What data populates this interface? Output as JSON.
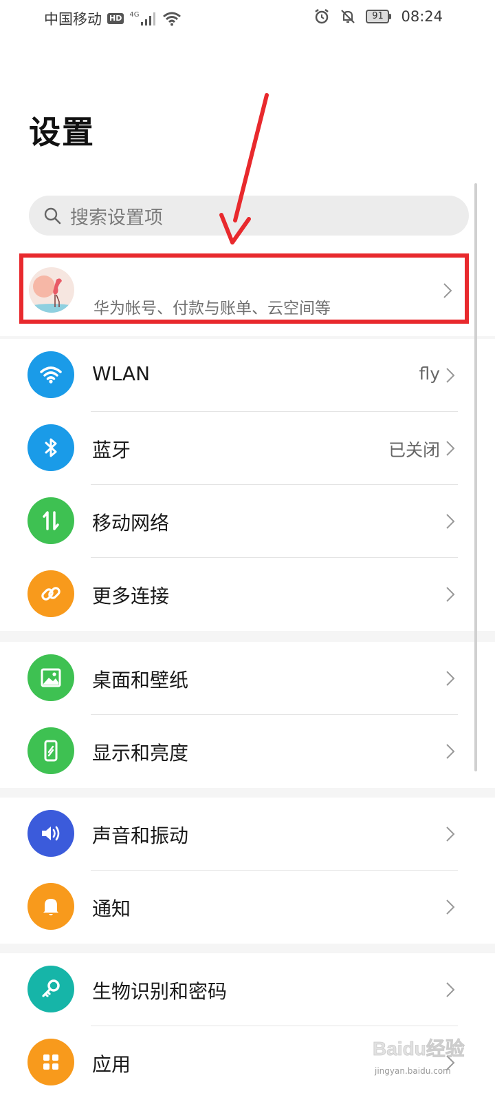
{
  "status_bar": {
    "carrier": "中国移动",
    "hd": "HD",
    "network_type": "4G",
    "battery": "91",
    "time": "08:24",
    "icons": [
      "signal-icon",
      "wifi-icon",
      "alarm-icon",
      "mute-icon",
      "battery-icon"
    ]
  },
  "page": {
    "title": "设置"
  },
  "search": {
    "placeholder": "搜索设置项"
  },
  "account": {
    "subtitle": "华为帐号、付款与账单、云空间等",
    "highlight_color": "#e8292d"
  },
  "groups": [
    {
      "items": [
        {
          "label": "WLAN",
          "value": "fly",
          "icon": "wifi-icon",
          "color": "#1a9be8"
        },
        {
          "label": "蓝牙",
          "value": "已关闭",
          "icon": "bluetooth-icon",
          "color": "#1a9be8"
        },
        {
          "label": "移动网络",
          "value": "",
          "icon": "mobile-data-icon",
          "color": "#3ec152"
        },
        {
          "label": "更多连接",
          "value": "",
          "icon": "link-icon",
          "color": "#f89a1c"
        }
      ]
    },
    {
      "items": [
        {
          "label": "桌面和壁纸",
          "value": "",
          "icon": "wallpaper-icon",
          "color": "#3ec152"
        },
        {
          "label": "显示和亮度",
          "value": "",
          "icon": "display-icon",
          "color": "#3ec152"
        }
      ]
    },
    {
      "items": [
        {
          "label": "声音和振动",
          "value": "",
          "icon": "sound-icon",
          "color": "#3b5bdb"
        },
        {
          "label": "通知",
          "value": "",
          "icon": "bell-icon",
          "color": "#f89a1c"
        }
      ]
    },
    {
      "items": [
        {
          "label": "生物识别和密码",
          "value": "",
          "icon": "key-icon",
          "color": "#16b5a8"
        },
        {
          "label": "应用",
          "value": "",
          "icon": "apps-icon",
          "color": "#f89a1c"
        }
      ]
    }
  ],
  "watermark": {
    "logo": "Baidu经验",
    "url": "jingyan.baidu.com"
  }
}
